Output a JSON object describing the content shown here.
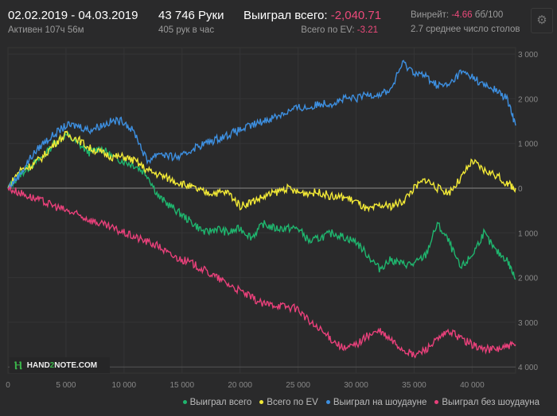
{
  "header": {
    "date_range": "02.02.2019 - 04.03.2019",
    "active": "Активен 107ч 56м",
    "hands": "43 746 Руки",
    "hands_per_hour": "405 рук в час",
    "won_label": "Выиграл всего:",
    "won_value": "-2,040.71",
    "ev_label": "Всего по EV:",
    "ev_value": "-3.21",
    "winrate_label": "Винрейт:",
    "winrate_value": "-4.66",
    "winrate_unit": "бб/100",
    "tables": "2.7 среднее число столов",
    "settings_icon": "gear-icon"
  },
  "logo": {
    "text_a": "HAND",
    "text_2": "2",
    "text_b": "NOTE.COM"
  },
  "chart_data": {
    "type": "line",
    "xlim": [
      0,
      43746
    ],
    "ylim": [
      -4200,
      3300
    ],
    "x_ticks": [
      "0",
      "5 000",
      "10 000",
      "15 000",
      "20 000",
      "25 000",
      "30 000",
      "35 000",
      "40 000"
    ],
    "x_tick_values": [
      0,
      5000,
      10000,
      15000,
      20000,
      25000,
      30000,
      35000,
      40000
    ],
    "y_ticks": [
      "3 000",
      "2 000",
      "1 000",
      "0",
      "1 000",
      "2 000",
      "3 000",
      "4 000"
    ],
    "y_tick_values": [
      3000,
      2000,
      1000,
      0,
      -1000,
      -2000,
      -3000,
      -4000
    ],
    "grid": true,
    "legend_position": "bottom-right",
    "x": [
      0,
      1000,
      2000,
      3000,
      4000,
      5000,
      6000,
      7000,
      8000,
      9000,
      10000,
      11000,
      12000,
      13000,
      14000,
      15000,
      16000,
      17000,
      18000,
      19000,
      20000,
      21000,
      22000,
      23000,
      24000,
      25000,
      26000,
      27000,
      28000,
      29000,
      30000,
      31000,
      32000,
      33000,
      34000,
      35000,
      36000,
      37000,
      38000,
      39000,
      40000,
      41000,
      42000,
      43000,
      43746
    ],
    "series": [
      {
        "name": "Выиграл всего",
        "color": "#1fb56e",
        "values": [
          0,
          300,
          500,
          700,
          1000,
          1200,
          1000,
          800,
          900,
          700,
          600,
          500,
          300,
          -200,
          -400,
          -600,
          -800,
          -1000,
          -900,
          -1000,
          -900,
          -1100,
          -800,
          -900,
          -900,
          -900,
          -1200,
          -1100,
          -1000,
          -1100,
          -1200,
          -1500,
          -1800,
          -1600,
          -1700,
          -1700,
          -1500,
          -800,
          -1200,
          -1800,
          -1500,
          -1000,
          -1400,
          -1600,
          -2040
        ]
      },
      {
        "name": "Всего по EV",
        "color": "#f2e936",
        "values": [
          0,
          400,
          500,
          700,
          1000,
          1200,
          1100,
          900,
          800,
          700,
          700,
          600,
          400,
          300,
          200,
          100,
          0,
          -100,
          -100,
          -100,
          -400,
          -300,
          -200,
          -100,
          0,
          -100,
          -100,
          -100,
          -200,
          -200,
          -300,
          -500,
          -400,
          -400,
          -300,
          0,
          200,
          0,
          -100,
          200,
          600,
          400,
          300,
          100,
          0
        ]
      },
      {
        "name": "Выиграл на шоудауне",
        "color": "#3d8fe0",
        "values": [
          0,
          300,
          700,
          1000,
          1200,
          1400,
          1400,
          1300,
          1400,
          1500,
          1500,
          1200,
          600,
          800,
          700,
          700,
          900,
          1000,
          1100,
          1200,
          1300,
          1400,
          1500,
          1600,
          1700,
          1800,
          1800,
          1900,
          1900,
          2000,
          2000,
          2100,
          2100,
          2200,
          2800,
          2600,
          2500,
          2300,
          2300,
          2600,
          2500,
          2300,
          2200,
          2000,
          1400
        ]
      },
      {
        "name": "Выиграл без шоудауна",
        "color": "#e8407a",
        "values": [
          0,
          -100,
          -200,
          -300,
          -400,
          -500,
          -600,
          -700,
          -800,
          -900,
          -1000,
          -1100,
          -1200,
          -1300,
          -1500,
          -1600,
          -1700,
          -1850,
          -2000,
          -2150,
          -2300,
          -2450,
          -2600,
          -2600,
          -2650,
          -2700,
          -3000,
          -3200,
          -3400,
          -3600,
          -3500,
          -3300,
          -3200,
          -3400,
          -3600,
          -3750,
          -3600,
          -3400,
          -3200,
          -3350,
          -3500,
          -3600,
          -3600,
          -3550,
          -3500
        ]
      }
    ]
  }
}
